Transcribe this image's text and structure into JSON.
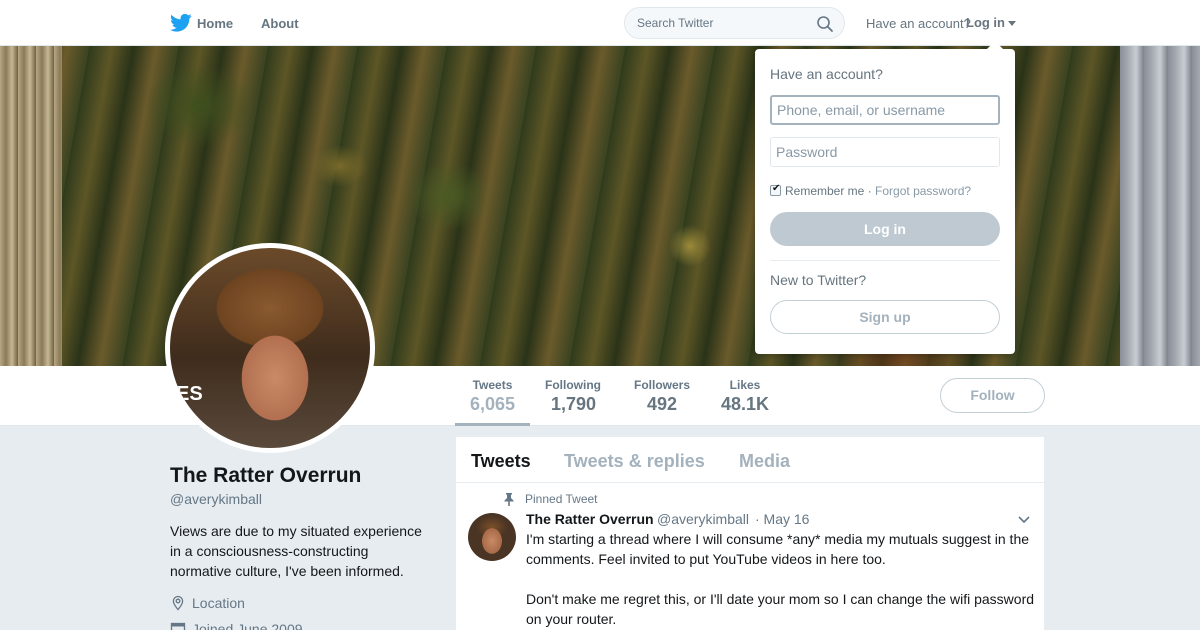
{
  "nav": {
    "home_label": "Home",
    "about_label": "About",
    "search_placeholder": "Search Twitter",
    "have_account": "Have an account?",
    "login_label": "Log in",
    "bird_icon": "twitter-bird-icon",
    "brand_color": "#1da1f2"
  },
  "stats": [
    {
      "label": "Tweets",
      "value": "6,065"
    },
    {
      "label": "Following",
      "value": "1,790"
    },
    {
      "label": "Followers",
      "value": "492"
    },
    {
      "label": "Likes",
      "value": "48.1K"
    }
  ],
  "follow_label": "Follow",
  "avatar_overlay_text": "ES",
  "profile": {
    "name": "The Ratter Overrun",
    "handle": "@averykimball",
    "bio": "Views are due to my situated experience in a consciousness-constructing normative culture, I've been informed.",
    "location": "Location",
    "joined": "Joined June 2009"
  },
  "timeline": {
    "tabs": [
      "Tweets",
      "Tweets & replies",
      "Media"
    ],
    "pinned_label": "Pinned Tweet",
    "tweet": {
      "name": "The Ratter Overrun",
      "handle": "@averykimball",
      "date": "· May 16",
      "paragraphs": [
        "I'm starting a thread where I will consume *any* media my mutuals suggest in the comments. Feel invited to put YouTube videos in here too.",
        "Don't make me regret this, or I'll date your mom so I can change the wifi password on your router."
      ]
    }
  },
  "login_dropdown": {
    "title": "Have an account?",
    "username_placeholder": "Phone, email, or username",
    "password_placeholder": "Password",
    "remember_label": "Remember me",
    "separator": "·",
    "forgot_label": "Forgot password?",
    "login_button": "Log in",
    "new_label": "New to Twitter?",
    "signup_button": "Sign up"
  }
}
